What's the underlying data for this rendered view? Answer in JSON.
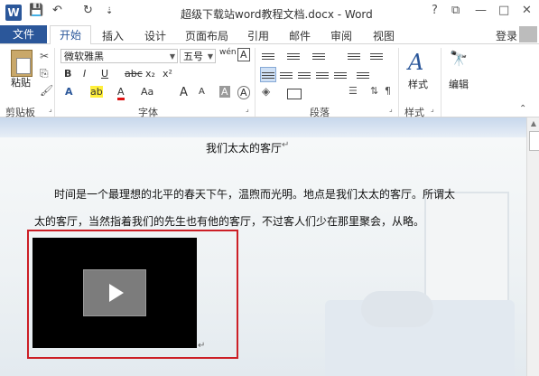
{
  "window": {
    "app_icon_letter": "W",
    "title": "超级下载站word教程文档.docx - Word",
    "help": "?",
    "restore": "⧉",
    "minimize": "—",
    "maximize": "□",
    "close": "✕"
  },
  "quick_access": {
    "save_icon": "💾",
    "undo_icon": "↶",
    "redo_icon": "↻",
    "customize_icon": "⇣"
  },
  "tabs": {
    "file": "文件",
    "items": [
      "开始",
      "插入",
      "设计",
      "页面布局",
      "引用",
      "邮件",
      "审阅",
      "视图"
    ],
    "login": "登录"
  },
  "ribbon": {
    "clipboard": {
      "paste": "粘贴",
      "label": "剪贴板"
    },
    "font": {
      "font_name": "微软雅黑",
      "font_size": "五号",
      "phonetic": "wén",
      "border_char": "A",
      "bold": "B",
      "italic": "I",
      "underline": "U",
      "strike": "abc",
      "subscript": "x₂",
      "superscript": "x²",
      "effects": "A",
      "highlight": "ab",
      "font_color": "A",
      "case": "Aa",
      "grow": "A",
      "shrink": "A",
      "shading": "A",
      "clear": "A",
      "label": "字体"
    },
    "paragraph": {
      "label": "段落"
    },
    "styles": {
      "icon": "A",
      "label": "样式",
      "group_label": "样式"
    },
    "editing": {
      "icon": "🔭",
      "label": "编辑"
    }
  },
  "document": {
    "title": "我们太太的客厅",
    "para1_line1": "时间是一个最理想的北平的春天下午，温煦而光明。地点是我们太太的客厅。所谓太",
    "para1_line2": "太的客厅，当然指着我们的先生也有他的客厅，不过客人们少在那里聚会，从略。",
    "return_mark": "↵",
    "video_play_icon": "play-icon"
  },
  "colors": {
    "accent": "#2b579a",
    "highlight_frame": "#cc1f26",
    "video_bg": "#000000"
  }
}
